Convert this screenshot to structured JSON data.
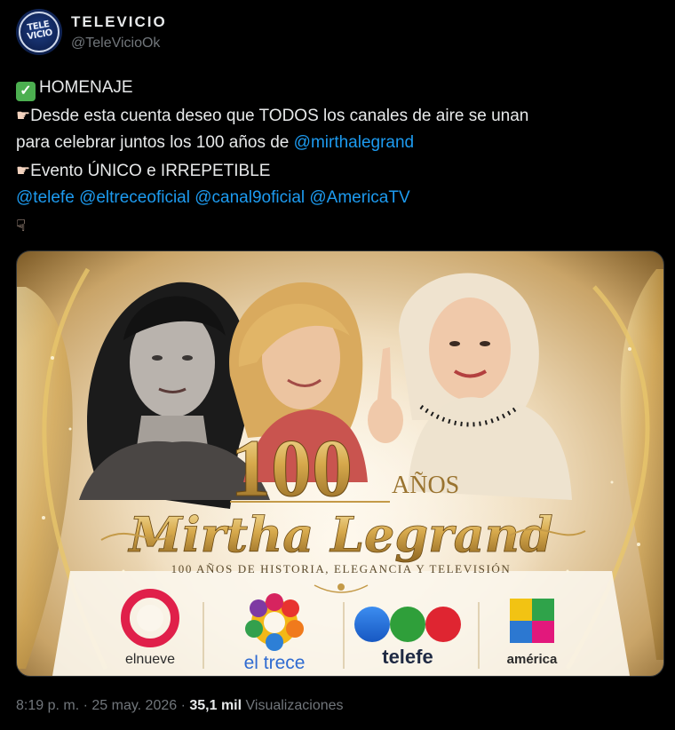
{
  "account": {
    "display_name": "TELEVICIO",
    "handle": "@TeleVicioOk",
    "avatar_text": "TELE VICIO"
  },
  "tweet": {
    "line1_text": "HOMENAJE",
    "line2_text": "Desde esta cuenta deseo que TODOS  los canales de aire se unan",
    "line3_text": "para celebrar juntos los 100 años de ",
    "line3_mention": "@mirthalegrand",
    "line4_text": "Evento ÚNICO e IRREPETIBLE",
    "mentions": [
      "@telefe",
      "@eltreceoficial",
      "@canal9oficial",
      "@AmericaTV"
    ]
  },
  "image": {
    "big_number": "100",
    "anos": "AÑOS",
    "name": "Mirtha Legrand",
    "subtitle": "100 AÑOS DE HISTORIA, ELEGANCIA Y TELEVISIÓN",
    "channels": [
      "elnueve",
      "el trece",
      "telefe",
      "américa"
    ]
  },
  "footer": {
    "time_date": "8:19 p. m. · 25 may. 2026 · ",
    "views_count": "35,1 mil",
    "views_label": "Visualizaciones"
  }
}
